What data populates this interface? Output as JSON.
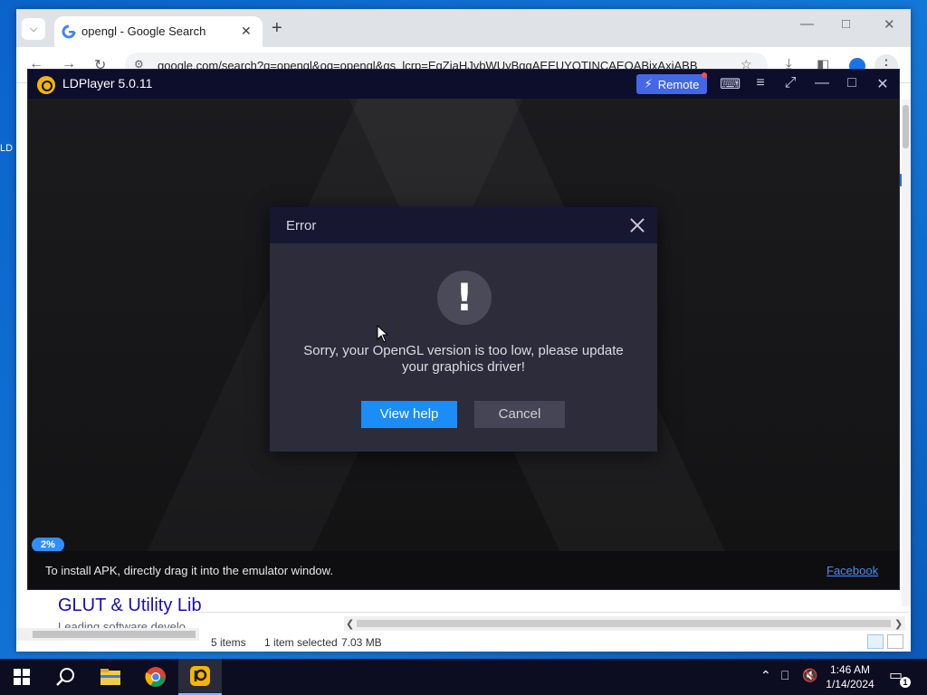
{
  "desktop": {
    "icon_label": "LD"
  },
  "chrome": {
    "tab_title": "opengl - Google Search",
    "url": "google.com/search?q=opengl&oq=opengl&gs_lcrp=EgZjaHJvbWUyBggAEEUYOTINCAEQABixAxiABB",
    "result_title": "GLUT & Utility Lib",
    "result_snippet": "Leading software develo"
  },
  "explorer": {
    "items_count": "5 items",
    "selected": "1 item selected",
    "size": "7.03 MB"
  },
  "ldplayer": {
    "title": "LDPlayer 5.0.11",
    "remote_label": "Remote",
    "progress": "2%",
    "tip": "To install APK, directly drag it into the emulator window.",
    "facebook_link": "Facebook"
  },
  "dialog": {
    "title": "Error",
    "icon": "!",
    "message": "Sorry, your OpenGL version is too low, please update your graphics driver!",
    "view_help": "View help",
    "cancel": "Cancel"
  },
  "taskbar": {
    "time": "1:46 AM",
    "date": "1/14/2024",
    "notification_count": "1"
  },
  "colors": {
    "accent_blue": "#1c8cf7",
    "ld_titlebar": "#0d0d2c",
    "remote_button": "#4367e6",
    "dialog_bg": "#2c2c3a"
  }
}
